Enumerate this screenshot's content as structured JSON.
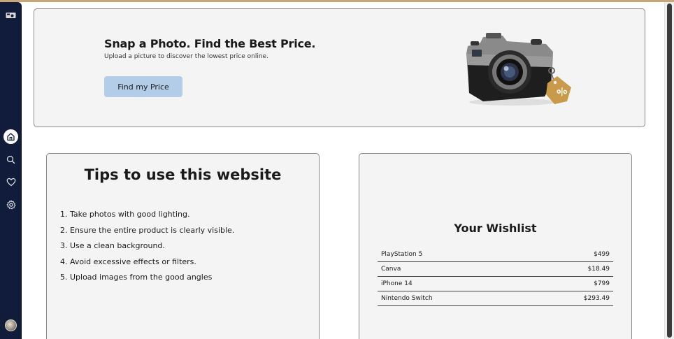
{
  "colors": {
    "sidebar_bg": "#101c3a",
    "button_bg": "#b3cde8",
    "card_bg": "#f4f4f4",
    "page_bg": "#ffffff"
  },
  "sidebar": {
    "items": [
      {
        "icon": "home-icon",
        "active": true
      },
      {
        "icon": "search-icon",
        "active": false
      },
      {
        "icon": "heart-icon",
        "active": false
      },
      {
        "icon": "gear-icon",
        "active": false
      }
    ]
  },
  "hero": {
    "title": "Snap a Photo. Find the Best Price.",
    "subtitle": "Upload a picture to discover the lowest price online.",
    "button_label": "Find my Price",
    "image_icon": "camera-with-price-tag-icon"
  },
  "tips": {
    "title": "Tips to use this website",
    "items": [
      "1. Take photos with good lighting.",
      "2. Ensure the entire product is clearly visible.",
      "3. Use a clean background.",
      "4. Avoid excessive effects or filters.",
      "5. Upload images from the good angles"
    ]
  },
  "wishlist": {
    "title": "Your Wishlist",
    "items": [
      {
        "name": "PlayStation 5",
        "price": "$499"
      },
      {
        "name": "Canva",
        "price": "$18.49"
      },
      {
        "name": "iPhone 14",
        "price": "$799"
      },
      {
        "name": "Nintendo Switch",
        "price": "$293.49"
      }
    ]
  }
}
